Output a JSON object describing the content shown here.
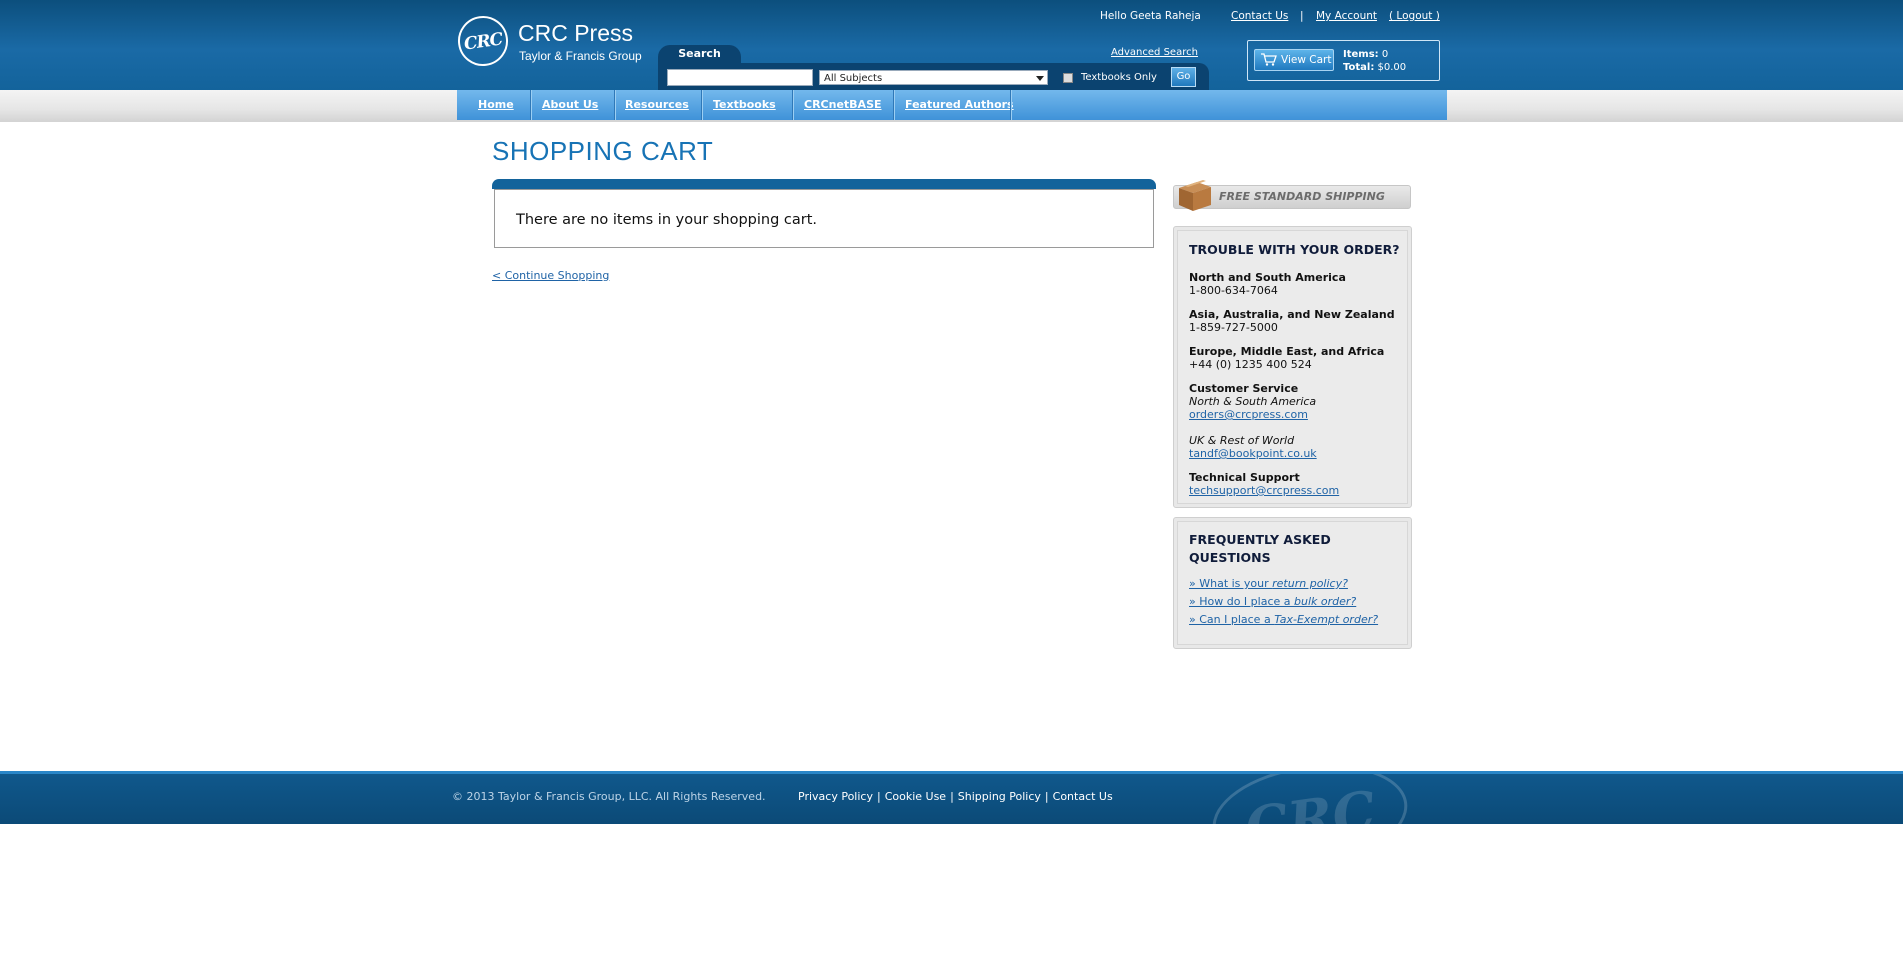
{
  "brand": {
    "logo_text": "CRC",
    "name": "CRC Press",
    "subtitle": "Taylor & Francis Group"
  },
  "utility_nav": {
    "greeting": "Hello Geeta Raheja",
    "contact": "Contact Us",
    "separator": "|",
    "my_account": "My Account",
    "logout": "( Logout )"
  },
  "search": {
    "tab_label": "Search",
    "query": "",
    "subject_selected": "All Subjects",
    "textbooks_only_label": "Textbooks Only",
    "textbooks_only_checked": false,
    "go_label": "Go",
    "advanced_link": "Advanced Search"
  },
  "cart_summary": {
    "button_label": "View Cart",
    "items_label": "Items:",
    "items_value": "0",
    "total_label": "Total:",
    "total_value": "$0.00"
  },
  "main_nav": {
    "items": [
      {
        "label": "Home"
      },
      {
        "label": "About Us"
      },
      {
        "label": "Resources"
      },
      {
        "label": "Textbooks"
      },
      {
        "label": "CRCnetBASE"
      },
      {
        "label": "Featured Authors"
      }
    ]
  },
  "page": {
    "title": "SHOPPING CART",
    "empty_message": "There are no items in your shopping cart.",
    "continue_link": "< Continue Shopping"
  },
  "sidebar": {
    "shipping_banner": "FREE STANDARD SHIPPING",
    "trouble": {
      "title": "TROUBLE WITH YOUR ORDER?",
      "regions": [
        {
          "name": "North and South America",
          "phone": "1-800-634-7064"
        },
        {
          "name": "Asia, Australia, and New Zealand",
          "phone": "1-859-727-5000"
        },
        {
          "name": "Europe, Middle East, and Africa",
          "phone": "+44 (0) 1235 400 524"
        }
      ],
      "customer_service_label": "Customer Service",
      "cs_na_label": "North & South America",
      "cs_na_email": "orders@crcpress.com",
      "cs_uk_label": "UK & Rest of World",
      "cs_uk_email": "tandf@bookpoint.co.uk",
      "tech_label": "Technical Support",
      "tech_email": "techsupport@crcpress.com"
    },
    "faq": {
      "title_line1": "FREQUENTLY ASKED",
      "title_line2": "QUESTIONS",
      "q1_prefix": "» What is your ",
      "q1_em": "return policy?",
      "q2_prefix": "» How do I place a ",
      "q2_em": "bulk order?",
      "q3_prefix": "» Can I place a ",
      "q3_em": "Tax-Exempt order?"
    }
  },
  "footer": {
    "copyright": "© 2013 Taylor & Francis Group, LLC. All Rights Reserved.",
    "links": [
      "Privacy Policy",
      "Cookie Use",
      "Shipping Policy",
      "Contact Us"
    ],
    "separator": "|",
    "watermark": "CRC"
  },
  "colors": {
    "header_blue": "#13639b",
    "nav_blue": "#4d9ee0",
    "title_blue": "#1773b5",
    "link_blue": "#1f63a6"
  }
}
